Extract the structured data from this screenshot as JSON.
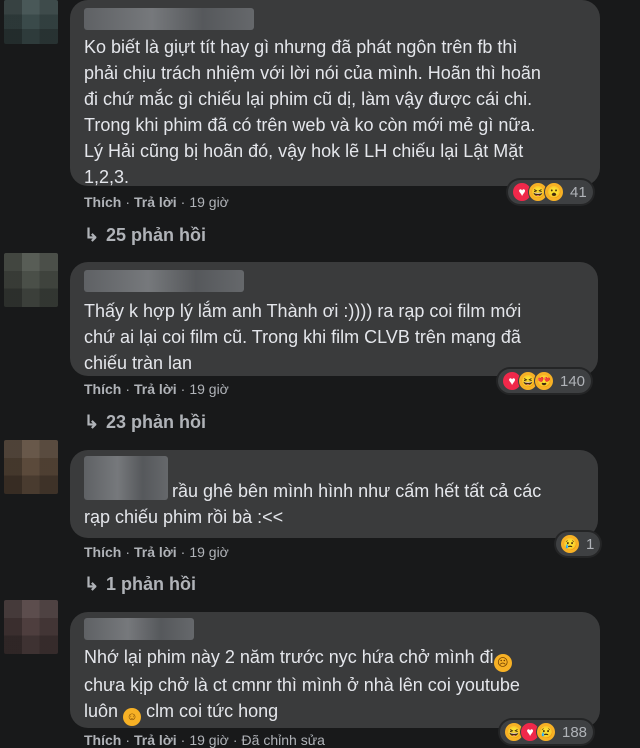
{
  "comments": [
    {
      "text": "Ko biết là giựt tít hay gì nhưng đã phát ngôn trên fb thì\nphải chịu trách nhiệm với lời nói của mình. Hoãn thì hoãn\nđi chứ mắc gì chiếu lại phim cũ dị, làm vậy được cái chi.\nTrong khi phim đã có trên web và ko còn mới mẻ gì nữa.\nLý Hải cũng bị hoãn đó, vậy hok lẽ LH chiếu lại Lật Mặt\n1,2,3.",
      "like_label": "Thích",
      "reply_label": "Trả lời",
      "time": "19 giờ",
      "reaction_count": "41",
      "replies_label": "25 phản hồi"
    },
    {
      "text": "Thấy k hợp lý lắm anh Thành ơi :)))) ra rạp coi film mới\nchứ ai lại coi film cũ. Trong khi film CLVB trên mạng đã\nchiếu tràn lan",
      "like_label": "Thích",
      "reply_label": "Trả lời",
      "time": "19 giờ",
      "reaction_count": "140",
      "replies_label": "23 phản hồi"
    },
    {
      "text_line1": "rầu ghê bên mình hình như cấm hết tất cả các",
      "text_line2": "rạp chiếu phim rồi bà :<<",
      "like_label": "Thích",
      "reply_label": "Trả lời",
      "time": "19 giờ",
      "reaction_count": "1",
      "replies_label": "1 phản hồi"
    },
    {
      "text_line1": "Nhớ lại phim này 2 năm trước nyc hứa chở mình đi",
      "text_line2": "chưa kịp chở là ct cmnr thì mình ở nhà lên coi youtube",
      "text_line3a": "luôn",
      "text_line3b": "clm coi tức hong",
      "like_label": "Thích",
      "reply_label": "Trả lời",
      "time": "19 giờ",
      "edited_label": "Đã chỉnh sửa",
      "reaction_count": "188"
    }
  ],
  "colors": {
    "background": "#18191a",
    "bubble": "#3a3b3c",
    "text": "#e4e6eb",
    "meta": "#b0b3b8"
  }
}
